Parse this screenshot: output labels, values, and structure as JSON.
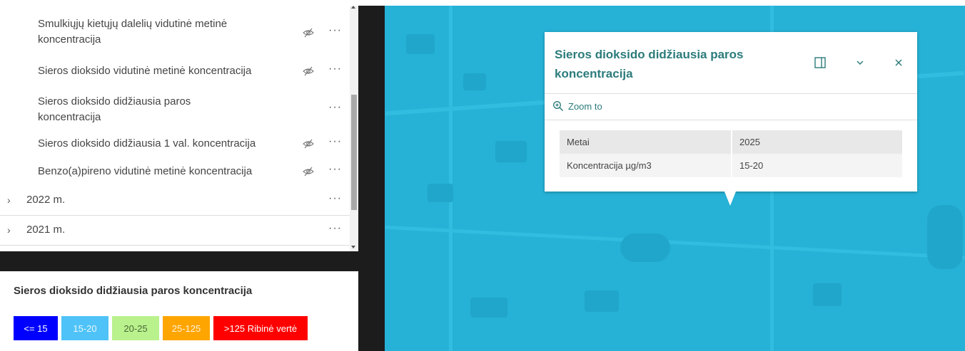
{
  "layers": [
    {
      "label": "Smulkiųjų kietųjų dalelių vidutinė metinė koncentracija",
      "eye": "eye-off-icon",
      "visible_eye": true
    },
    {
      "label": "Sieros dioksido vidutinė metinė koncentracija",
      "eye": "eye-off-icon",
      "visible_eye": true
    },
    {
      "label": "Sieros dioksido didžiausia paros koncentracija",
      "eye": "",
      "visible_eye": false
    },
    {
      "label": "Sieros dioksido didžiausia 1 val. koncentracija",
      "eye": "eye-off-icon",
      "visible_eye": true
    },
    {
      "label": "Benzo(a)pireno vidutinė metinė koncentracija",
      "eye": "eye-off-icon",
      "visible_eye": true
    }
  ],
  "groups": [
    {
      "label": "2022 m."
    },
    {
      "label": "2021 m."
    }
  ],
  "more_label": "···",
  "chevron": "›",
  "legend": {
    "title": "Sieros dioksido didžiausia paros koncentracija",
    "items": [
      {
        "label": "<= 15",
        "color": "#0000ff",
        "text_color": "#ffffff"
      },
      {
        "label": "15-20",
        "color": "#4fc3f7",
        "text_color": "#e8f6fd"
      },
      {
        "label": "20-25",
        "color": "#b9f18c",
        "text_color": "#4a6a3a"
      },
      {
        "label": "25-125",
        "color": "#ffa500",
        "text_color": "#fff3dd"
      },
      {
        "label": ">125 Ribinė vertė",
        "color": "#ff0000",
        "text_color": "#ffffff"
      }
    ]
  },
  "popup": {
    "title": "Sieros dioksido didžiausia paros koncentracija",
    "zoom_label": "Zoom to",
    "attributes": [
      {
        "name": "Metai",
        "value": "2025"
      },
      {
        "name": "Koncentracija µg/m3",
        "value": "15-20"
      }
    ]
  },
  "colors": {
    "map": "#26b1d6",
    "accent": "#2c7b7b"
  }
}
